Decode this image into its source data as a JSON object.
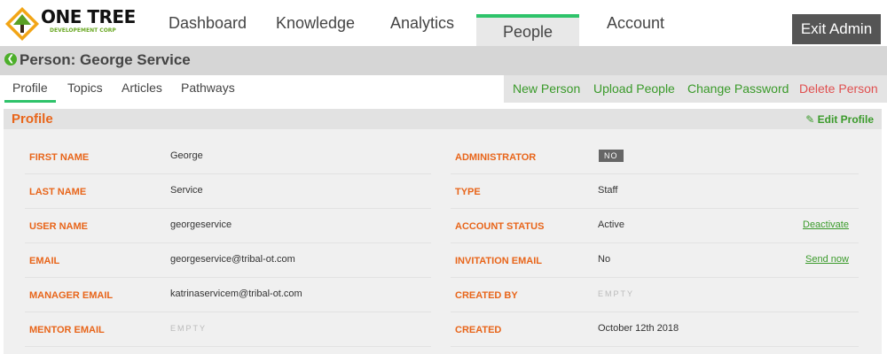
{
  "brand": {
    "name": "ONE TREE",
    "tagline": "DEVELOPEMENT CORP"
  },
  "nav": {
    "items": [
      {
        "label": "Dashboard"
      },
      {
        "label": "Knowledge"
      },
      {
        "label": "Analytics"
      },
      {
        "label": "People"
      },
      {
        "label": "Account"
      }
    ],
    "active": "People",
    "exit_label": "Exit Admin"
  },
  "person": {
    "title": "Person: George Service"
  },
  "subtabs": [
    {
      "label": "Profile"
    },
    {
      "label": "Topics"
    },
    {
      "label": "Articles"
    },
    {
      "label": "Pathways"
    }
  ],
  "actions": {
    "new_person": "New Person",
    "upload_people": "Upload People",
    "change_password": "Change Password",
    "delete_person": "Delete Person"
  },
  "profile": {
    "heading": "Profile",
    "edit_label": "Edit Profile",
    "left": [
      {
        "label": "FIRST NAME",
        "value": "George"
      },
      {
        "label": "LAST NAME",
        "value": "Service"
      },
      {
        "label": "USER NAME",
        "value": "georgeservice"
      },
      {
        "label": "EMAIL",
        "value": "georgeservice@tribal-ot.com"
      },
      {
        "label": "MANAGER EMAIL",
        "value": "katrinaservicem@tribal-ot.com"
      },
      {
        "label": "MENTOR EMAIL",
        "value": "EMPTY"
      }
    ],
    "right": [
      {
        "label": "ADMINISTRATOR",
        "value": "NO"
      },
      {
        "label": "TYPE",
        "value": "Staff"
      },
      {
        "label": "ACCOUNT STATUS",
        "value": "Active",
        "link": "Deactivate"
      },
      {
        "label": "INVITATION EMAIL",
        "value": "No",
        "link": "Send now"
      },
      {
        "label": "CREATED BY",
        "value": "EMPTY"
      },
      {
        "label": "CREATED",
        "value": "October 12th 2018"
      }
    ]
  },
  "colors": {
    "accent_orange": "#e8651a",
    "accent_green": "#2ec36a",
    "link_green": "#3a9a2a",
    "danger": "#e05050"
  }
}
